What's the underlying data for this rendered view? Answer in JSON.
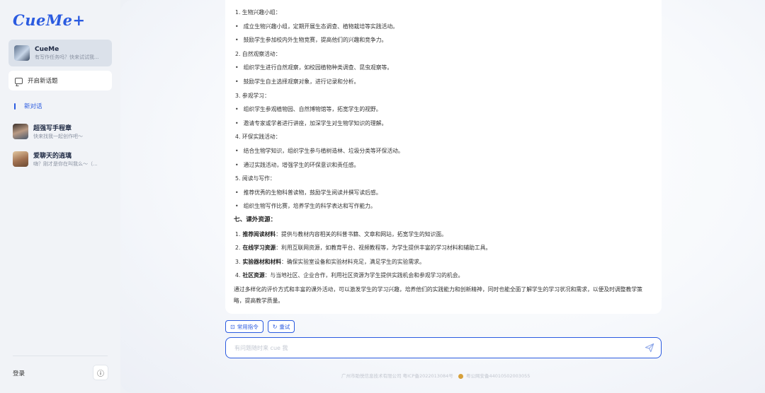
{
  "logo": "CueMe+",
  "sidebar": {
    "bot": {
      "name": "CueMe",
      "subtitle": "有写作任务吗？快来试试我..."
    },
    "new_topic": "开启新话题",
    "new_chat": "新对话",
    "conversations": [
      {
        "name": "超强写手程章",
        "subtitle": "快来找我一起创作吧～"
      },
      {
        "name": "爱聊天的逍璃",
        "subtitle": "嗨？刚才是你在叫我么～（..."
      }
    ],
    "login": "登录",
    "info_icon": "info-icon"
  },
  "answer": {
    "lines": [
      {
        "type": "num",
        "text": "1. 生物兴趣小组："
      },
      {
        "type": "bul",
        "text": "成立生物兴趣小组，定期开展生态调查、植物栽培等实践活动。"
      },
      {
        "type": "bul",
        "text": "鼓励学生参加校内外生物竞赛，提高他们的兴趣和竞争力。"
      },
      {
        "type": "num",
        "text": "2. 自然观察活动："
      },
      {
        "type": "bul",
        "text": "组织学生进行自然观察，如校园植物种类调查、昆虫观察等。"
      },
      {
        "type": "bul",
        "text": "鼓励学生自主选择观察对象，进行记录和分析。"
      },
      {
        "type": "num",
        "text": "3. 参观学习："
      },
      {
        "type": "bul",
        "text": "组织学生参观植物园、自然博物馆等，拓宽学生的视野。"
      },
      {
        "type": "bul",
        "text": "邀请专家或学者进行讲座，加深学生对生物学知识的理解。"
      },
      {
        "type": "num",
        "text": "4. 环保实践活动："
      },
      {
        "type": "bul",
        "text": "结合生物学知识，组织学生参与植树造林、垃圾分类等环保活动。"
      },
      {
        "type": "bul",
        "text": "通过实践活动，增强学生的环保意识和责任感。"
      },
      {
        "type": "num",
        "text": "5. 阅读与写作："
      },
      {
        "type": "bul",
        "text": "推荐优秀的生物科普读物，鼓励学生阅读并撰写读后感。"
      },
      {
        "type": "bul",
        "text": "组织生物写作比赛，培养学生的科学表达和写作能力。"
      }
    ],
    "section7_title": "七、课外资源：",
    "resources": [
      {
        "num": "1.",
        "bold": "推荐阅读材料",
        "text": "：提供与教材内容相关的科普书籍、文章和网站，拓宽学生的知识面。"
      },
      {
        "num": "2.",
        "bold": "在线学习资源",
        "text": "：利用互联网资源，如教育平台、视频教程等，为学生提供丰富的学习材料和辅助工具。"
      },
      {
        "num": "3.",
        "bold": "实验器材和材料",
        "text": "：确保实验室设备和实验材料充足，满足学生的实验需求。"
      },
      {
        "num": "4.",
        "bold": "社区资源",
        "text": "：与当地社区、企业合作，利用社区资源为学生提供实践机会和参观学习的机会。"
      }
    ],
    "conclusion": "通过多样化的评价方式和丰富的课外活动，可以激发学生的学习兴趣，培养他们的实践能力和创新精神，同时也能全面了解学生的学习状况和需求，以便及时调整教学策略，提高教学质量。"
  },
  "chips": {
    "commands": "常用指令",
    "retry": "重试"
  },
  "input": {
    "placeholder": "有问题随时来 cue 我",
    "value": ""
  },
  "footer": {
    "company": "广州市助悦信息技术有限公司  粤ICP备2022013084号",
    "police": "粤公网安备44010502003055"
  },
  "colors": {
    "accent": "#2b5be0"
  }
}
